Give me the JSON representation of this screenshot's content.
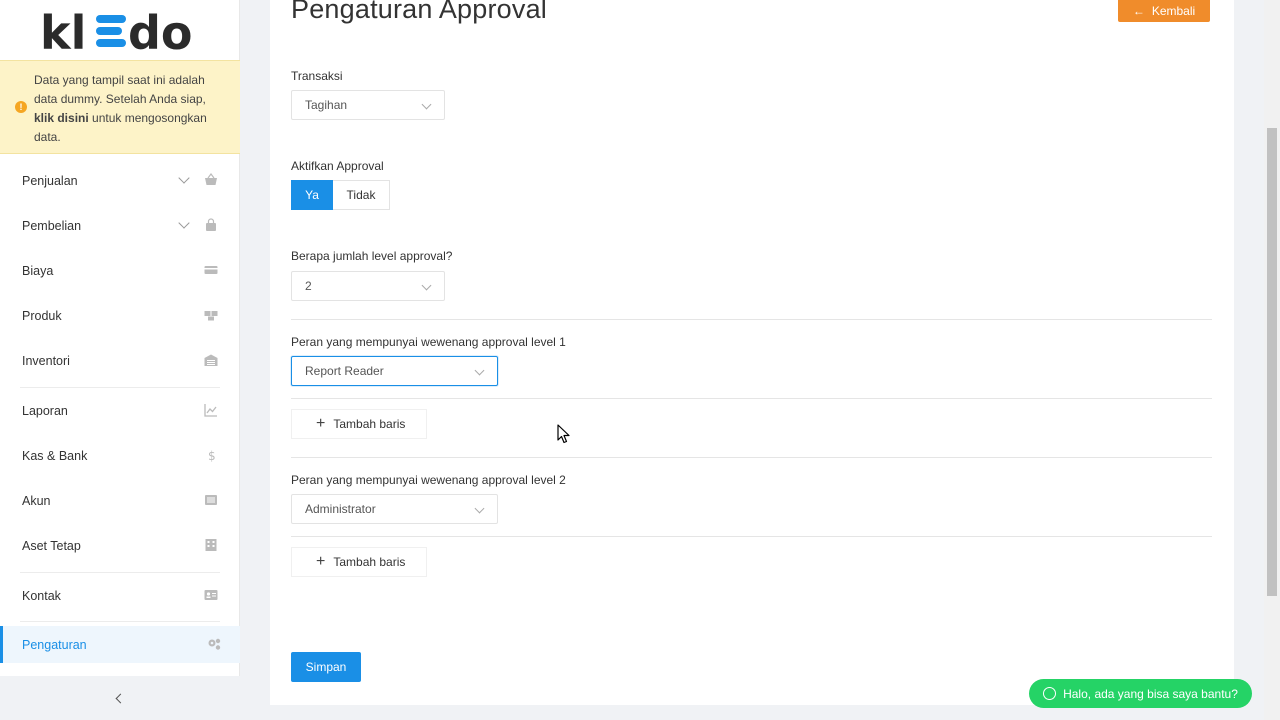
{
  "brand": {
    "logo_text": "kledo",
    "accent": "#1a8fe6"
  },
  "notice": {
    "before": "Data yang tampil saat ini adalah data dummy. Setelah Anda siap, ",
    "link": "klik disini",
    "after": " untuk mengosongkan data."
  },
  "sidebar": {
    "items": [
      {
        "label": "Penjualan",
        "icon": "basket-icon",
        "expandable": true
      },
      {
        "label": "Pembelian",
        "icon": "bag-icon",
        "expandable": true
      },
      {
        "label": "Biaya",
        "icon": "credit-card-icon"
      },
      {
        "label": "Produk",
        "icon": "boxes-icon"
      },
      {
        "label": "Inventori",
        "icon": "warehouse-icon"
      },
      {
        "label": "Laporan",
        "icon": "line-chart-icon"
      },
      {
        "label": "Kas & Bank",
        "icon": "dollar-icon"
      },
      {
        "label": "Akun",
        "icon": "list-icon"
      },
      {
        "label": "Aset Tetap",
        "icon": "building-icon"
      },
      {
        "label": "Kontak",
        "icon": "contact-card-icon"
      },
      {
        "label": "Pengaturan",
        "icon": "gears-icon",
        "active": true
      }
    ]
  },
  "page": {
    "title": "Pengaturan Approval",
    "back_label": "Kembali",
    "transaksi_label": "Transaksi",
    "transaksi_value": "Tagihan",
    "aktifkan_label": "Aktifkan Approval",
    "toggle_yes": "Ya",
    "toggle_no": "Tidak",
    "level_count_label": "Berapa jumlah level approval?",
    "level_count_value": "2",
    "level1_label": "Peran yang mempunyai wewenang approval level 1",
    "level1_value": "Report Reader",
    "level2_label": "Peran yang mempunyai wewenang approval level 2",
    "level2_value": "Administrator",
    "add_row_label": "Tambah baris",
    "save_label": "Simpan"
  },
  "chat": {
    "label": "Halo, ada yang bisa saya bantu?"
  },
  "colors": {
    "primary": "#1a8fe6",
    "back_button": "#f08c2b",
    "whatsapp": "#25d366",
    "notice_bg": "#fdf3c8"
  }
}
